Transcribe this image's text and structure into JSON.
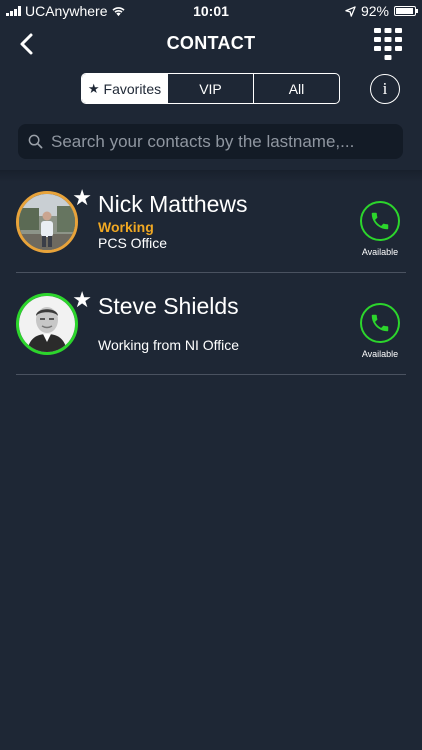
{
  "status_bar": {
    "carrier": "UCAnywhere",
    "time": "10:01",
    "battery": "92%",
    "battery_level": 0.92,
    "icons": [
      "signal-icon",
      "wifi-icon",
      "location-arrow-icon",
      "battery-icon"
    ]
  },
  "header": {
    "title": "CONTACT",
    "back_icon": "chevron-left-icon",
    "dialpad_icon": "dialpad-icon"
  },
  "tabs": [
    {
      "label": "Favorites",
      "icon": "star-icon",
      "active": true
    },
    {
      "label": "VIP",
      "active": false
    },
    {
      "label": "All",
      "active": false
    }
  ],
  "info_label": "i",
  "search": {
    "placeholder": "Search your contacts by the lastname,..."
  },
  "contacts": [
    {
      "name": "Nick Matthews",
      "status": "Working",
      "location": "PCS Office",
      "presence": "Available",
      "ring_color": "#e8a33a",
      "favorite": true
    },
    {
      "name": "Steve Shields",
      "status": "",
      "location": "Working from NI Office",
      "presence": "Available",
      "ring_color": "#2cd52c",
      "favorite": true
    }
  ],
  "colors": {
    "background": "#1e2735",
    "search_bg": "#131b26",
    "status_working": "#f0a823",
    "available_green": "#2cd52c"
  }
}
